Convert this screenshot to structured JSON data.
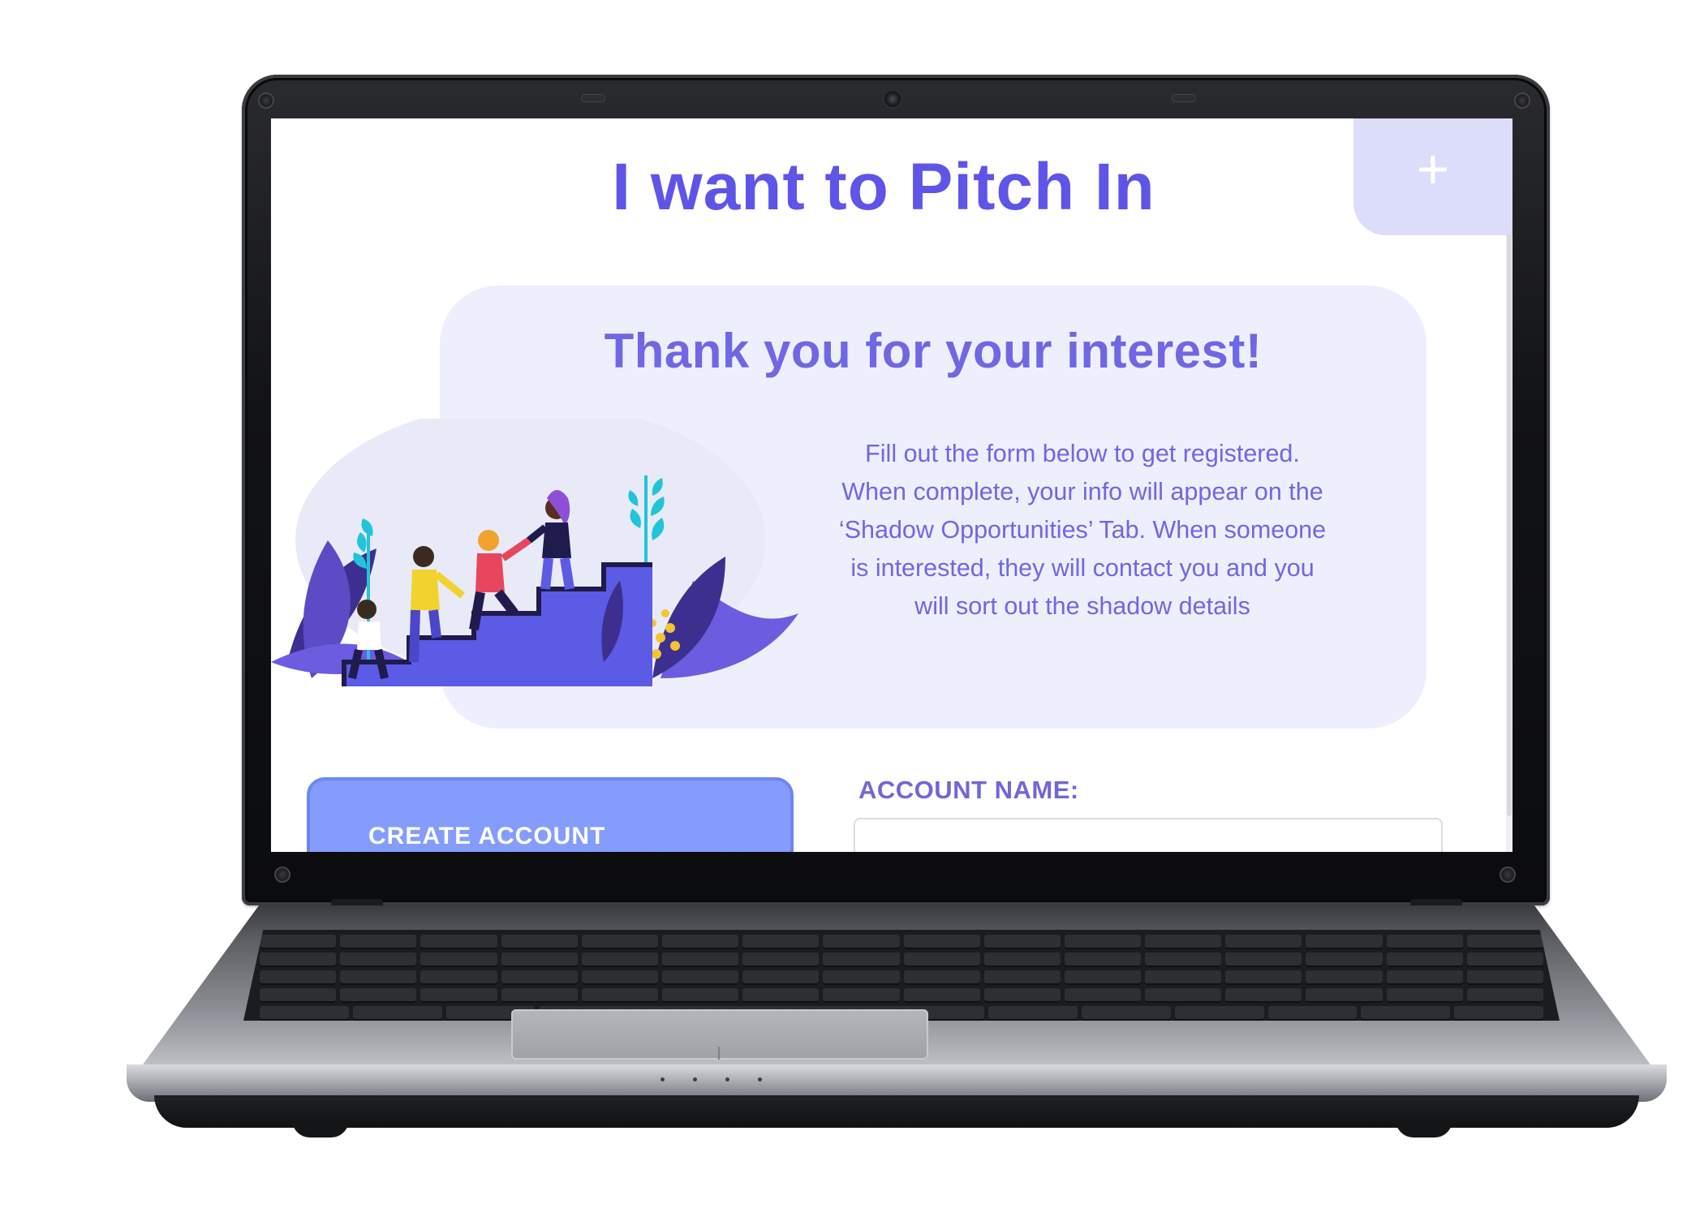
{
  "page": {
    "title": "I want to Pitch In",
    "plus_icon_glyph": "+",
    "accent_color": "#5e55e8",
    "card_background": "#eeeffd"
  },
  "card": {
    "heading": "Thank you for your interest!",
    "lines": [
      "Fill out the form below to get registered.",
      "When complete, your info will appear on the",
      "‘Shadow Opportunities’ Tab. When someone",
      "is interested, they will contact you and you",
      "will sort out the shadow details"
    ],
    "illustration_icon": "people-climbing-stairs-illustration"
  },
  "form": {
    "create_account_label": "CREATE ACCOUNT",
    "account_name_label": "ACCOUNT NAME:",
    "account_name_value": ""
  }
}
